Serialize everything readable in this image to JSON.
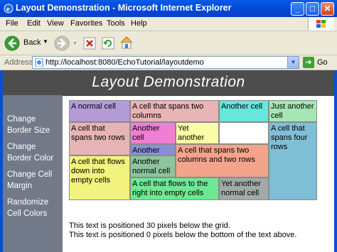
{
  "window": {
    "title": "Layout Demonstration - Microsoft Internet Explorer",
    "title_icon": "ie-icon",
    "buttons": [
      "minimize-icon",
      "maximize-icon",
      "close-icon"
    ]
  },
  "menu": {
    "items": [
      "File",
      "Edit",
      "View",
      "Favorites",
      "Tools",
      "Help"
    ]
  },
  "toolbar": {
    "back_label": "Back",
    "icons": [
      "back-arrow-icon",
      "dropdown-arrow-icon",
      "forward-arrow-icon",
      "stop-icon",
      "refresh-icon",
      "home-icon"
    ]
  },
  "address": {
    "label": "Address",
    "url": "http://localhost:8080/EchoTutorial/layoutdemo",
    "go_label": "Go"
  },
  "page": {
    "heading": "Layout Demonstration",
    "sidebar": [
      {
        "label": "Change Border Size"
      },
      {
        "label": "Change Border Color"
      },
      {
        "label": "Change Cell Margin"
      },
      {
        "label": "Randomize Cell Colors"
      }
    ],
    "cells": [
      {
        "text": "A normal cell",
        "color": "#b49bd8"
      },
      {
        "text": "A cell that spans two columns",
        "color": "#e8b4b4"
      },
      {
        "text": "Another cell",
        "color": "#66e6dc"
      },
      {
        "text": "Just another cell",
        "color": "#a6e6b4"
      },
      {
        "text": "A cell that spans two rows",
        "color": "#e6b4b4"
      },
      {
        "text": "Another cell",
        "color": "#f07ed4"
      },
      {
        "text": "Yet another cell",
        "color": "#fdfda8"
      },
      {
        "text": "",
        "color": "#ffffff"
      },
      {
        "text": "A cell that spans four rows",
        "color": "#7fbfd6"
      },
      {
        "text": "Another cell",
        "color": "#8a8ed8"
      },
      {
        "text": "A cell that spans two columns and two rows",
        "color": "#f4a48a"
      },
      {
        "text": "A cell that flows down into empty cells",
        "color": "#f2f27e"
      },
      {
        "text": "Another normal cell",
        "color": "#8cc49c"
      },
      {
        "text": "A cell that flows to the right into empty cells",
        "color": "#6ee892"
      },
      {
        "text": "Yet another normal cell",
        "color": "#a2aaa8"
      }
    ],
    "notes": [
      "This text is positioned 30 pixels below the grid.",
      "This text is positioned 0 pixels below the bottom of the text above."
    ]
  }
}
